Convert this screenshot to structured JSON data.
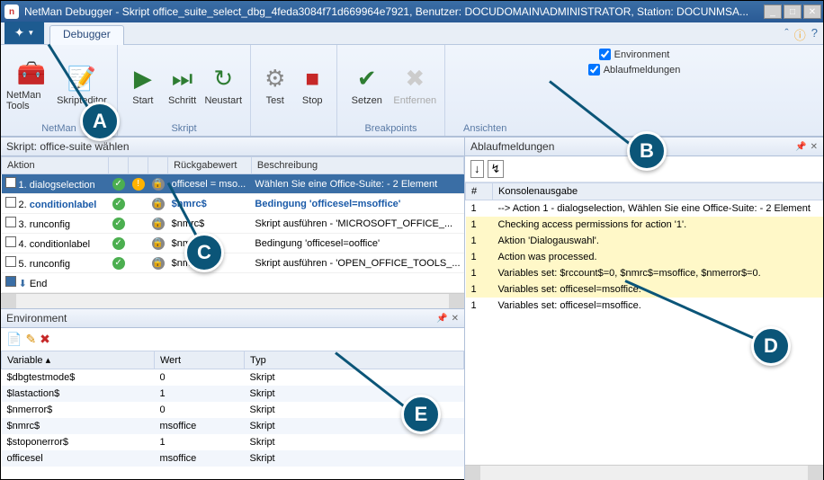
{
  "titlebar": {
    "app": "NetMan Debugger",
    "text": "NetMan Debugger - Skript office_suite_select_dbg_4feda3084f71d669964e7921, Benutzer: DOCUDOMAIN\\ADMINISTRATOR, Station: DOCUNMSA..."
  },
  "tabbar": {
    "debugger": "Debugger"
  },
  "ribbon": {
    "netmanTools": "NetMan Tools",
    "skripteditor": "Skripteditor",
    "start": "Start",
    "schritt": "Schritt",
    "neustart": "Neustart",
    "test": "Test",
    "stop": "Stop",
    "setzen": "Setzen",
    "entfernen": "Entfernen",
    "chkEnvironment": "Environment",
    "chkAblauf": "Ablaufmeldungen",
    "groups": {
      "netman": "NetMan",
      "skript": "Skript",
      "breakpoints": "Breakpoints",
      "ansichten": "Ansichten"
    }
  },
  "skriptPanel": {
    "title": "Skript: office-suite wählen",
    "cols": {
      "aktion": "Aktion",
      "ruck": "Rückgabewert",
      "besch": "Beschreibung"
    },
    "rows": [
      {
        "chk": false,
        "sel": true,
        "idx": "1.",
        "name": "dialogselection",
        "link": false,
        "stat": [
          "green",
          "yellow",
          "lock"
        ],
        "ruck": "officesel = mso...",
        "besch": "Wählen Sie eine Office-Suite: - 2 Element"
      },
      {
        "chk": false,
        "sel": false,
        "idx": "2.",
        "name": "conditionlabel",
        "link": true,
        "stat": [
          "green",
          "",
          "lock"
        ],
        "ruck": "$nmrc$",
        "besch": "Bedingung 'officesel=msoffice'"
      },
      {
        "chk": false,
        "sel": false,
        "idx": "3.",
        "name": "runconfig",
        "link": false,
        "stat": [
          "green",
          "",
          "lock"
        ],
        "ruck": "$nmrc$",
        "besch": "Skript ausführen - 'MICROSOFT_OFFICE_..."
      },
      {
        "chk": false,
        "sel": false,
        "idx": "4.",
        "name": "conditionlabel",
        "link": false,
        "stat": [
          "green",
          "",
          "lock"
        ],
        "ruck": "$nmrc$",
        "besch": "Bedingung 'officesel=ooffice'"
      },
      {
        "chk": false,
        "sel": false,
        "idx": "5.",
        "name": "runconfig",
        "link": false,
        "stat": [
          "green",
          "",
          "lock"
        ],
        "ruck": "$nmrc$",
        "besch": "Skript ausführen - 'OPEN_OFFICE_TOOLS_..."
      },
      {
        "chk": true,
        "sel": false,
        "idx": "",
        "name": "End",
        "link": false,
        "stat": [
          "",
          "",
          ""
        ],
        "ruck": "",
        "besch": "",
        "endIcon": true
      }
    ]
  },
  "envPanel": {
    "title": "Environment",
    "cols": {
      "var": "Variable",
      "wert": "Wert",
      "typ": "Typ"
    },
    "rows": [
      {
        "var": "$dbgtestmode$",
        "wert": "0",
        "typ": "Skript"
      },
      {
        "var": "$lastaction$",
        "wert": "1",
        "typ": "Skript"
      },
      {
        "var": "$nmerror$",
        "wert": "0",
        "typ": "Skript"
      },
      {
        "var": "$nmrc$",
        "wert": "msoffice",
        "typ": "Skript"
      },
      {
        "var": "$stoponerror$",
        "wert": "1",
        "typ": "Skript"
      },
      {
        "var": "officesel",
        "wert": "msoffice",
        "typ": "Skript"
      }
    ]
  },
  "logPanel": {
    "title": "Ablaufmeldungen",
    "cols": {
      "num": "#",
      "msg": "Konsolenausgabe"
    },
    "rows": [
      {
        "n": "1",
        "hl": false,
        "msg": "--> Action 1 - dialogselection, Wählen Sie eine Office-Suite: - 2 Element"
      },
      {
        "n": "1",
        "hl": true,
        "msg": "Checking access permissions for action '1'."
      },
      {
        "n": "1",
        "hl": true,
        "msg": "Aktion 'Dialogauswahl'."
      },
      {
        "n": "1",
        "hl": true,
        "msg": "Action was processed."
      },
      {
        "n": "1",
        "hl": true,
        "msg": "Variables set: $rccount$=0, $nmrc$=msoffice, $nmerror$=0."
      },
      {
        "n": "1",
        "hl": true,
        "msg": "Variables set: officesel=msoffice."
      },
      {
        "n": "1",
        "hl": false,
        "msg": "Variables set: officesel=msoffice."
      }
    ]
  },
  "callouts": {
    "A": "A",
    "B": "B",
    "C": "C",
    "D": "D",
    "E": "E"
  }
}
